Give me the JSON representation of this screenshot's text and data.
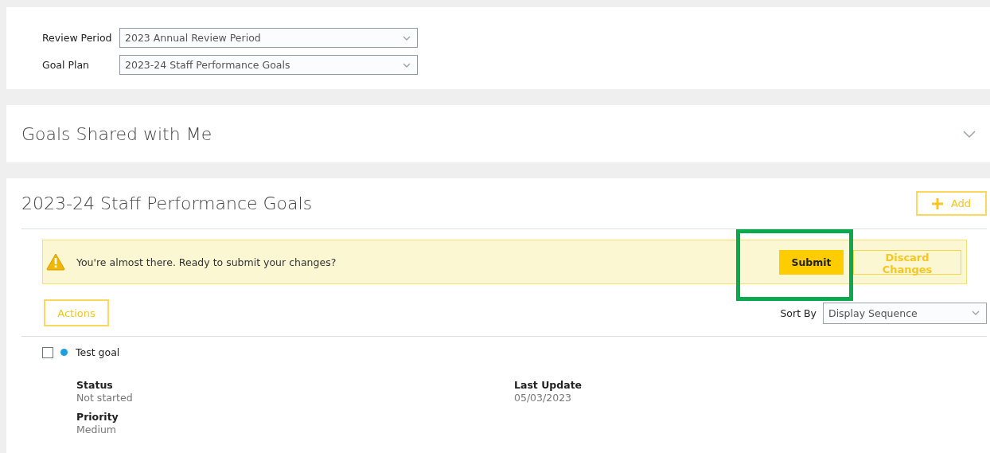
{
  "filters": [
    {
      "label": "Review Period",
      "value": "2023 Annual Review Period"
    },
    {
      "label": "Goal Plan",
      "value": "2023-24 Staff Performance Goals"
    }
  ],
  "shared_section": {
    "title": "Goals Shared with Me",
    "expanded": false
  },
  "goals_section": {
    "title": "2023-24 Staff Performance Goals",
    "add_button": "Add",
    "alert": {
      "message": "You're almost there. Ready to submit your changes?",
      "submit": "Submit",
      "discard": "Discard Changes"
    },
    "actions_button": "Actions",
    "sort": {
      "label": "Sort By",
      "value": "Display Sequence"
    },
    "goals": [
      {
        "title": "Test goal",
        "checked": false,
        "color": "#1ba1e2",
        "fields": [
          {
            "label": "Status",
            "value": "Not started"
          },
          {
            "label": "Last Update",
            "value": "05/03/2023"
          },
          {
            "label": "Priority",
            "value": "Medium"
          }
        ]
      }
    ]
  }
}
